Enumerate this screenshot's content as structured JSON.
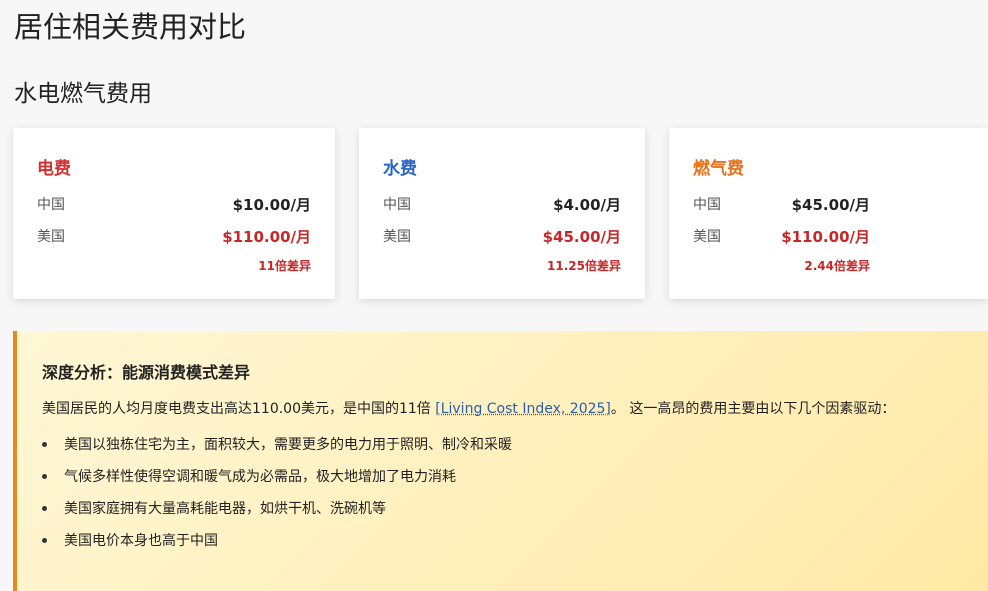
{
  "page": {
    "title": "居住相关费用对比"
  },
  "section": {
    "title": "水电燃气费用"
  },
  "cards": [
    {
      "title": "电费",
      "title_color": "#d32f2f",
      "cn_label": "中国",
      "cn_value": "$10.00/月",
      "us_label": "美国",
      "us_value": "$110.00/月",
      "diff": "11倍差异"
    },
    {
      "title": "水费",
      "title_color": "#2a63c4",
      "cn_label": "中国",
      "cn_value": "$4.00/月",
      "us_label": "美国",
      "us_value": "$45.00/月",
      "diff": "11.25倍差异"
    },
    {
      "title": "燃气费",
      "title_color": "#e8701a",
      "cn_label": "中国",
      "cn_value": "$45.00/月",
      "us_label": "美国",
      "us_value": "$110.00/月",
      "diff": "2.44倍差异"
    }
  ],
  "analysis": {
    "title": "深度分析：能源消费模式差异",
    "para_before": "美国居民的人均月度电费支出高达110.00美元，是中国的11倍 ",
    "citation": "[Living Cost Index, 2025]",
    "para_after": "。 这一高昂的费用主要由以下几个因素驱动：",
    "bullets": [
      "美国以独栋住宅为主，面积较大，需要更多的电力用于照明、制冷和采暖",
      "气候多样性使得空调和暖气成为必需品，极大地增加了电力消耗",
      "美国家庭拥有大量高耗能电器，如烘干机、洗碗机等",
      "美国电价本身也高于中国"
    ]
  }
}
